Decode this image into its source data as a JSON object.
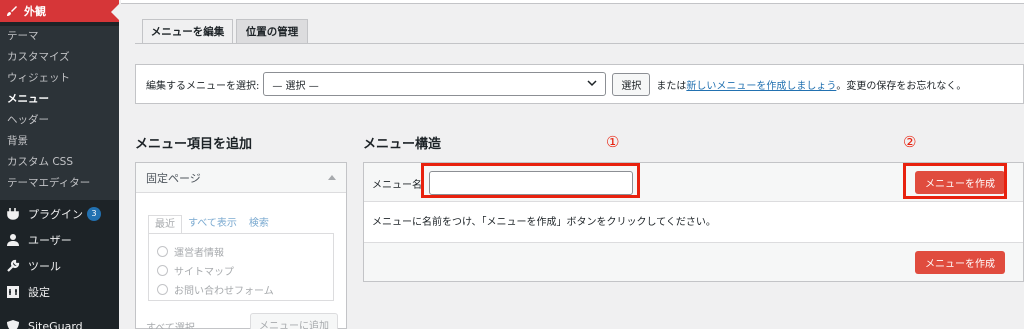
{
  "sidebar": {
    "appearance": "外観",
    "submenu": [
      "テーマ",
      "カスタマイズ",
      "ウィジェット",
      "メニュー",
      "ヘッダー",
      "背景",
      "カスタム CSS",
      "テーマエディター"
    ],
    "plugins": "プラグイン",
    "plugins_badge": "3",
    "users": "ユーザー",
    "tools": "ツール",
    "settings": "設定",
    "siteguard": "SiteGuard"
  },
  "tabs": [
    "メニューを編集",
    "位置の管理"
  ],
  "select_bar": {
    "label": "編集するメニューを選択:",
    "selected": "— 選択 —",
    "select_button": "選択",
    "or_text": "または",
    "create_link": "新しいメニューを作成しましょう",
    "after_link": "。変更の保存をお忘れなく。"
  },
  "left": {
    "title": "メニュー項目を追加",
    "section": "固定ページ",
    "subtabs": [
      "最近",
      "すべて表示",
      "検索"
    ],
    "pages": [
      "運営者情報",
      "サイトマップ",
      "お問い合わせフォーム"
    ],
    "select_all": "すべて選択",
    "add_button": "メニューに追加"
  },
  "right": {
    "title": "メニュー構造",
    "name_label": "メニュー名",
    "name_value": "",
    "create_button": "メニューを作成",
    "instruction": "メニューに名前をつけ、「メニューを作成」ボタンをクリックしてください。"
  },
  "annotations": {
    "one": "①",
    "two": "②"
  },
  "colors": {
    "highlight": "#e8210e",
    "button": "#e04c3e",
    "sidebar": "#1d2327",
    "active_menu": "#d63638"
  }
}
